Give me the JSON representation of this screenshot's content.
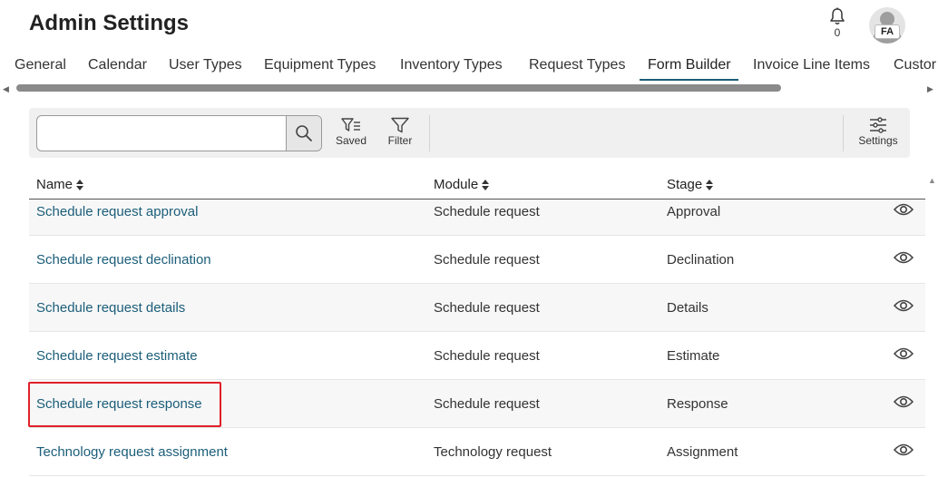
{
  "header": {
    "title": "Admin Settings",
    "notifications_count": "0",
    "avatar_initials": "FA"
  },
  "tabs": [
    {
      "label": "General"
    },
    {
      "label": "Calendar"
    },
    {
      "label": "User Types"
    },
    {
      "label": "Equipment Types"
    },
    {
      "label": "Inventory Types"
    },
    {
      "label": "Request Types"
    },
    {
      "label": "Form Builder",
      "active": true
    },
    {
      "label": "Invoice Line Items"
    },
    {
      "label": "Custor"
    }
  ],
  "toolbar": {
    "search_placeholder": "",
    "saved_label": "Saved",
    "filter_label": "Filter",
    "settings_label": "Settings"
  },
  "table": {
    "columns": [
      "Name",
      "Module",
      "Stage"
    ],
    "rows": [
      {
        "name": "Schedule request approval",
        "module": "Schedule request",
        "stage": "Approval"
      },
      {
        "name": "Schedule request declination",
        "module": "Schedule request",
        "stage": "Declination"
      },
      {
        "name": "Schedule request details",
        "module": "Schedule request",
        "stage": "Details"
      },
      {
        "name": "Schedule request estimate",
        "module": "Schedule request",
        "stage": "Estimate"
      },
      {
        "name": "Schedule request response",
        "module": "Schedule request",
        "stage": "Response",
        "highlighted": true
      },
      {
        "name": "Technology request assignment",
        "module": "Technology request",
        "stage": "Assignment"
      }
    ]
  },
  "colors": {
    "link": "#1b5e7a",
    "highlight_border": "#e0202a",
    "toolbar_bg": "#f0f0f0"
  },
  "icons": [
    "bell-icon",
    "avatar-icon",
    "search-icon",
    "saved-filter-icon",
    "filter-icon",
    "settings-sliders-icon",
    "sort-icon",
    "eye-icon"
  ]
}
